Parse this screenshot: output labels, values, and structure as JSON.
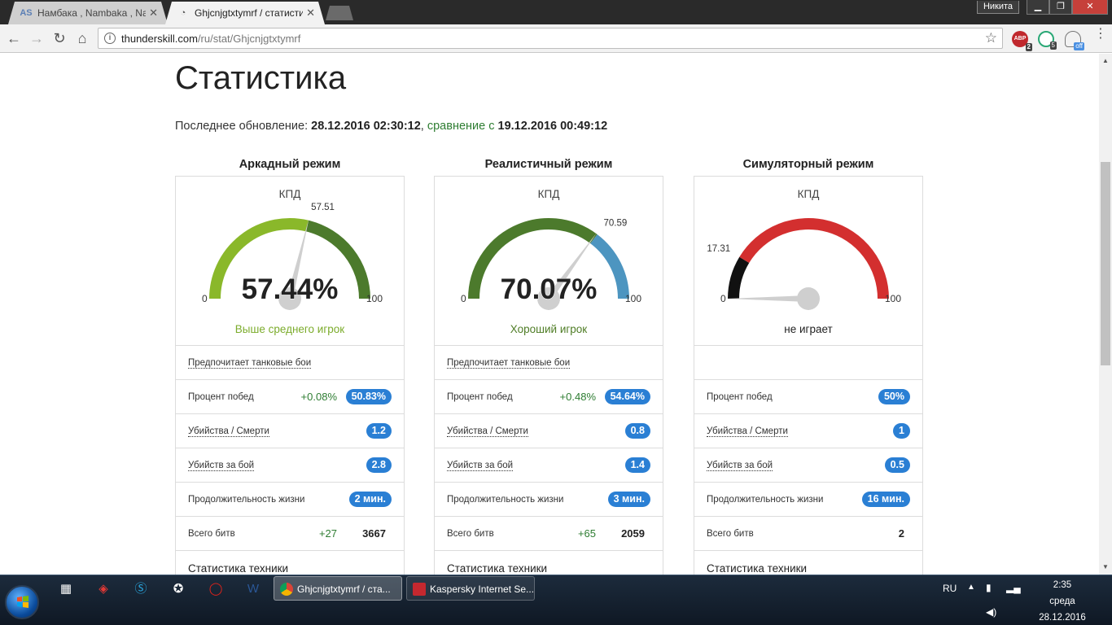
{
  "browser": {
    "tabs": [
      {
        "title": "Намбака , Nambaka , Na",
        "favicon": "AS",
        "active": false
      },
      {
        "title": "Ghjcnjgtxtymrf / статистика",
        "favicon": "gauge-icon",
        "active": true
      }
    ],
    "profile_name": "Никита",
    "url_domain": "thunderskill.com",
    "url_path": "/ru/stat/Ghjcnjgtxtymrf",
    "extensions": [
      {
        "name": "adblock-plus",
        "label": "ABP",
        "badge": "2"
      },
      {
        "name": "green-extension",
        "badge": "5"
      },
      {
        "name": "notification-extension",
        "badge": "off"
      }
    ]
  },
  "page": {
    "title": "Статистика",
    "update_label": "Последнее обновление:",
    "update_date": "28.12.2016 02:30:12",
    "comparison_word": "сравнение",
    "comparison_prefix": "с",
    "comparison_date": "19.12.2016 00:49:12"
  },
  "modes": [
    {
      "title": "Аркадный режим",
      "gauge_label": "КПД",
      "value": 57.44,
      "value_text": "57.44%",
      "marker_text": "57.51",
      "marker": 57.51,
      "min_label": "0",
      "max_label": "100",
      "status": "Выше среднего игрок",
      "status_color": "#7cac2c",
      "bands": [
        {
          "from": 0,
          "to": 57.51,
          "color": "#8ab82a"
        },
        {
          "from": 57.51,
          "to": 100,
          "color": "#4c7a2c"
        }
      ],
      "rows": [
        {
          "label": "Предпочитает танковые бои",
          "dotted": true
        },
        {
          "label": "Процент побед",
          "delta": "+0.08%",
          "pill": "50.83%"
        },
        {
          "label": "Убийства / Смерти",
          "dotted": true,
          "pill": "1.2"
        },
        {
          "label": "Убийств за бой",
          "dotted": true,
          "pill": "2.8"
        },
        {
          "label": "Продолжительность жизни",
          "pill": "2 мин."
        },
        {
          "label": "Всего битв",
          "delta": "+27",
          "plain": "3667"
        }
      ],
      "tech_link": "Статистика техники"
    },
    {
      "title": "Реалистичный режим",
      "gauge_label": "КПД",
      "value": 70.07,
      "value_text": "70.07%",
      "marker_text": "70.59",
      "marker": 70.59,
      "min_label": "0",
      "max_label": "100",
      "status": "Хороший игрок",
      "status_color": "#4f7d26",
      "bands": [
        {
          "from": 0,
          "to": 70.59,
          "color": "#4c7a2c"
        },
        {
          "from": 70.59,
          "to": 100,
          "color": "#4d95c0"
        }
      ],
      "rows": [
        {
          "label": "Предпочитает танковые бои",
          "dotted": true
        },
        {
          "label": "Процент побед",
          "delta": "+0.48%",
          "pill": "54.64%"
        },
        {
          "label": "Убийства / Смерти",
          "dotted": true,
          "pill": "0.8"
        },
        {
          "label": "Убийств за бой",
          "dotted": true,
          "pill": "1.4"
        },
        {
          "label": "Продолжительность жизни",
          "pill": "3 мин."
        },
        {
          "label": "Всего битв",
          "delta": "+65",
          "plain": "2059"
        }
      ],
      "tech_link": "Статистика техники"
    },
    {
      "title": "Симуляторный режим",
      "gauge_label": "КПД",
      "value": 0,
      "value_text": "",
      "marker_text": "17.31",
      "marker": 17.31,
      "min_label": "0",
      "max_label": "100",
      "status": "не играет",
      "status_color": "#222222",
      "bands": [
        {
          "from": 0,
          "to": 17.31,
          "color": "#111111"
        },
        {
          "from": 17.31,
          "to": 100,
          "color": "#d32f2f"
        }
      ],
      "rows": [
        {
          "label": "",
          "empty": true
        },
        {
          "label": "Процент побед",
          "pill": "50%"
        },
        {
          "label": "Убийства / Смерти",
          "dotted": true,
          "pill": "1"
        },
        {
          "label": "Убийств за бой",
          "dotted": true,
          "pill": "0.5"
        },
        {
          "label": "Продолжительность жизни",
          "pill": "16 мин."
        },
        {
          "label": "Всего битв",
          "plain": "2"
        }
      ],
      "tech_link": "Статистика техники"
    }
  ],
  "taskbar": {
    "tasks": [
      {
        "title": "Ghjcnjgtxtymrf / ста...",
        "app": "chrome"
      },
      {
        "title": "Kaspersky Internet Se...",
        "app": "kaspersky"
      }
    ],
    "lang": "RU",
    "time": "2:35",
    "day": "среда",
    "date": "28.12.2016"
  }
}
